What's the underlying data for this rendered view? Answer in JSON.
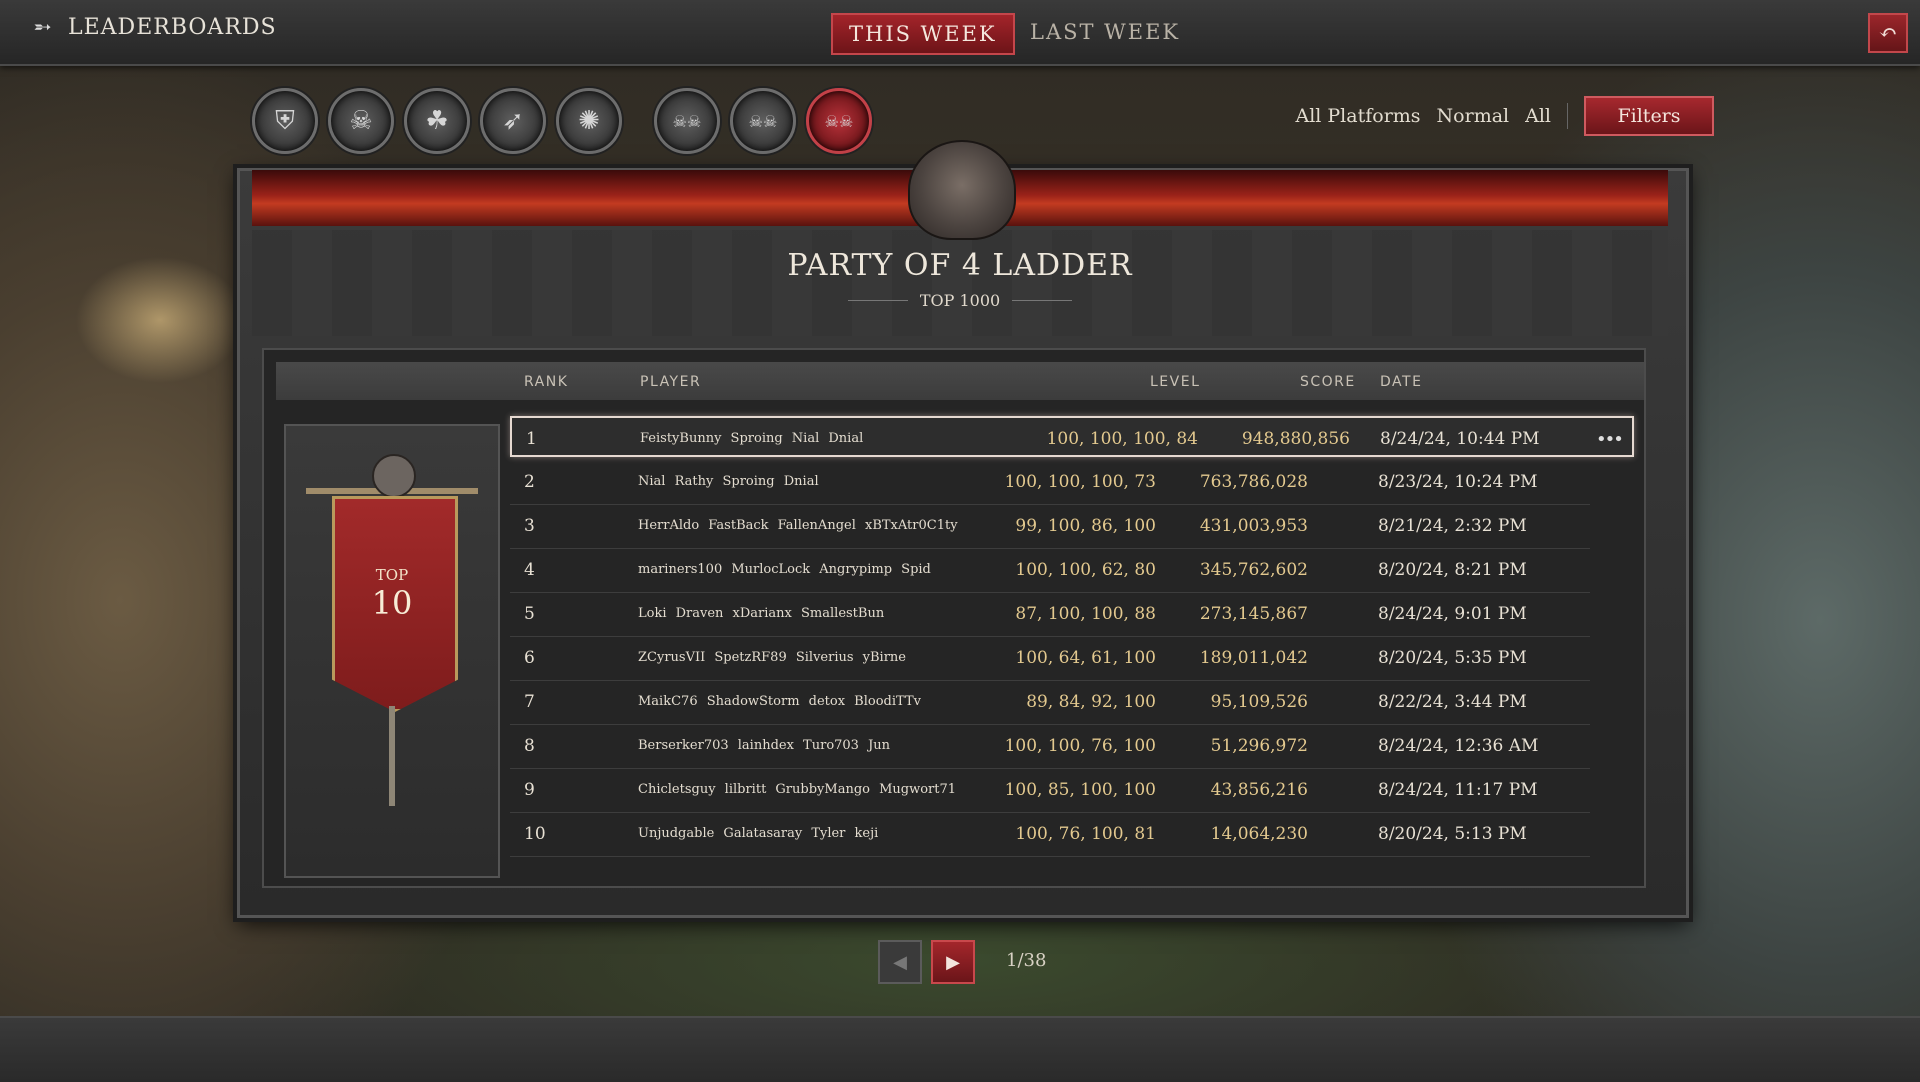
{
  "header": {
    "title": "LEADERBOARDS",
    "tabs": [
      {
        "label": "THIS WEEK",
        "active": true
      },
      {
        "label": "LAST WEEK",
        "active": false
      }
    ]
  },
  "class_icons": [
    {
      "name": "barbarian-icon",
      "glyph": "⛨"
    },
    {
      "name": "necromancer-icon",
      "glyph": "☠"
    },
    {
      "name": "druid-icon",
      "glyph": "☘"
    },
    {
      "name": "rogue-icon",
      "glyph": "➶"
    },
    {
      "name": "sorcerer-icon",
      "glyph": "✺"
    },
    {
      "name": "party-of-2-icon",
      "glyph": "☠☠"
    },
    {
      "name": "party-of-3-icon",
      "glyph": "☠☠"
    },
    {
      "name": "party-of-4-icon",
      "glyph": "☠☠",
      "selected": true
    }
  ],
  "filters": {
    "platform": "All Platforms",
    "difficulty": "Normal",
    "mode": "All",
    "button": "Filters"
  },
  "ladder": {
    "title": "PARTY OF 4 LADDER",
    "subtitle": "TOP 1000"
  },
  "columns": {
    "rank": "RANK",
    "player": "PLAYER",
    "level": "LEVEL",
    "score": "SCORE",
    "date": "DATE"
  },
  "banner": {
    "top": "TOP",
    "num": "10"
  },
  "rows": [
    {
      "rank": "1",
      "player": "FeistyBunny Sproing Nial Dnial",
      "level": "100, 100, 100, 84",
      "score": "948,880,856",
      "date": "8/24/24, 10:44 PM"
    },
    {
      "rank": "2",
      "player": "Nial Rathy Sproing Dnial",
      "level": "100, 100, 100, 73",
      "score": "763,786,028",
      "date": "8/23/24, 10:24 PM"
    },
    {
      "rank": "3",
      "player": "HerrAldo FastBack FallenAngel xBTxAtr0C1ty",
      "level": "99, 100, 86, 100",
      "score": "431,003,953",
      "date": "8/21/24, 2:32 PM"
    },
    {
      "rank": "4",
      "player": "mariners100 MurlocLock Angrypimp Spid",
      "level": "100, 100, 62, 80",
      "score": "345,762,602",
      "date": "8/20/24, 8:21 PM"
    },
    {
      "rank": "5",
      "player": "Loki Draven xDarianx SmallestBun",
      "level": "87, 100, 100, 88",
      "score": "273,145,867",
      "date": "8/24/24, 9:01 PM"
    },
    {
      "rank": "6",
      "player": "ZCyrusVII SpetzRF89 Silverius yBirne",
      "level": "100, 64, 61, 100",
      "score": "189,011,042",
      "date": "8/20/24, 5:35 PM"
    },
    {
      "rank": "7",
      "player": "MaikC76 ShadowStorm detox BloodiTTv",
      "level": "89, 84, 92, 100",
      "score": "95,109,526",
      "date": "8/22/24, 3:44 PM"
    },
    {
      "rank": "8",
      "player": "Berserker703 lainhdex Turo703 Jun",
      "level": "100, 100, 76, 100",
      "score": "51,296,972",
      "date": "8/24/24, 12:36 AM"
    },
    {
      "rank": "9",
      "player": "Chicletsguy lilbritt GrubbyMango Mugwort71",
      "level": "100, 85, 100, 100",
      "score": "43,856,216",
      "date": "8/24/24, 11:17 PM"
    },
    {
      "rank": "10",
      "player": "Unjudgable Galatasaray Tyler keji",
      "level": "100, 76, 100, 81",
      "score": "14,064,230",
      "date": "8/20/24, 5:13 PM"
    }
  ],
  "row_more": "•••",
  "pagination": {
    "text": "1/38"
  }
}
